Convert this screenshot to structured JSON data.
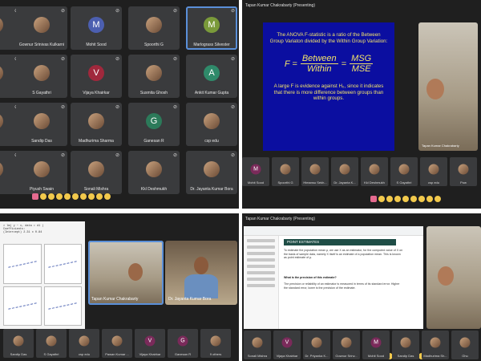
{
  "q1": {
    "rows": [
      [
        {
          "name": "",
          "avatar": "photo"
        },
        {
          "name": "Gownur Srinivas Kulkarni",
          "avatar": "photo"
        },
        {
          "name": "Mohit Sood",
          "initial": "M",
          "color": "#4c5fb0"
        },
        {
          "name": "Spoorthi G",
          "avatar": "photo"
        },
        {
          "name": "Marlograss Silvester",
          "initial": "M",
          "color": "#7a9a3a",
          "speaking": true
        }
      ],
      [
        {
          "name": "ri",
          "avatar": "photo"
        },
        {
          "name": "S Gayathri",
          "avatar": "photo"
        },
        {
          "name": "Vijaya Khairkar",
          "initial": "V",
          "color": "#a0283c"
        },
        {
          "name": "Susmita Ghosh",
          "avatar": "photo"
        },
        {
          "name": "Ankit Kumar Gupta",
          "initial": "A",
          "color": "#2f8a6a"
        }
      ],
      [
        {
          "name": "ra",
          "avatar": "photo"
        },
        {
          "name": "Sandip Das",
          "avatar": "photo"
        },
        {
          "name": "Madhurima Sharma",
          "avatar": "photo"
        },
        {
          "name": "Ganesan R",
          "initial": "G",
          "color": "#2c7a5a"
        },
        {
          "name": "csp edu",
          "avatar": "photo"
        }
      ],
      [
        {
          "name": "s",
          "avatar": "photo"
        },
        {
          "name": "Piyush Swain",
          "avatar": "photo"
        },
        {
          "name": "Sonali Mishra",
          "avatar": "photo"
        },
        {
          "name": "Kkl Deshmukh",
          "avatar": "photo"
        },
        {
          "name": "Dr. Jayanta Kumar Bora",
          "avatar": "photo"
        }
      ]
    ]
  },
  "q2": {
    "presenting": "Tapan Kumar Chakrabarty (Presenting)",
    "slide": {
      "intro": "The ANOVA F-statistic is a ratio of the Between Group Variaton divided by the Within Group Variation:",
      "lhs": "F =",
      "num1": "Between",
      "den1": "Within",
      "eq": "=",
      "num2": "MSG",
      "den2": "MSE",
      "outro": "A large F is evidence against H₀, since it indicates that there is more difference between groups than within groups."
    },
    "presenter_name": "Tapan Kumar Chakrabarty",
    "strip": [
      "Mohit Sood",
      "Spoorthi G",
      "Himansu Sekh...",
      "Dr. Jayanta K...",
      "Kkl Deshmukh",
      "S Gayathri",
      "csp edu",
      "Pow"
    ]
  },
  "q3": {
    "presenter_tile": "Tapan Kumar Chakrabarty",
    "second_tile": "Dr. Jayanta Kumar Bora",
    "strip": [
      "Sandip Das",
      "S Gayathri",
      "csp edu",
      "Pawan Kumar ...",
      "Vijaya Khairkar",
      "Ganesan R",
      "9 others"
    ],
    "strip_initials": [
      "",
      "",
      "",
      "",
      "V",
      "G",
      ""
    ]
  },
  "q4": {
    "presenting": "Tapan Kumar Chakrabarty (Presenting)",
    "doc_heading": "POINT ESTIMATES",
    "doc_para1": "To estimate the population mean μ, we use X as an estimator, for the computed value of X on the basis of sample data, namely X itself is an estimate of a population mean. This is known as point estimate of μ.",
    "doc_q": "What is the precision of this estimate?",
    "doc_para2": "The precision or reliability of an estimator is measured in terms of its standard error. Higher the standard error, lower is the precision of the estimate.",
    "strip": [
      "Sonali Mishra",
      "Vijaya Khairkar",
      "Dr. Priyanka K...",
      "Gownur Srinv...",
      "Mohit Sood",
      "Sandip Das",
      "Madhurima Sh...",
      "Ghu"
    ]
  }
}
